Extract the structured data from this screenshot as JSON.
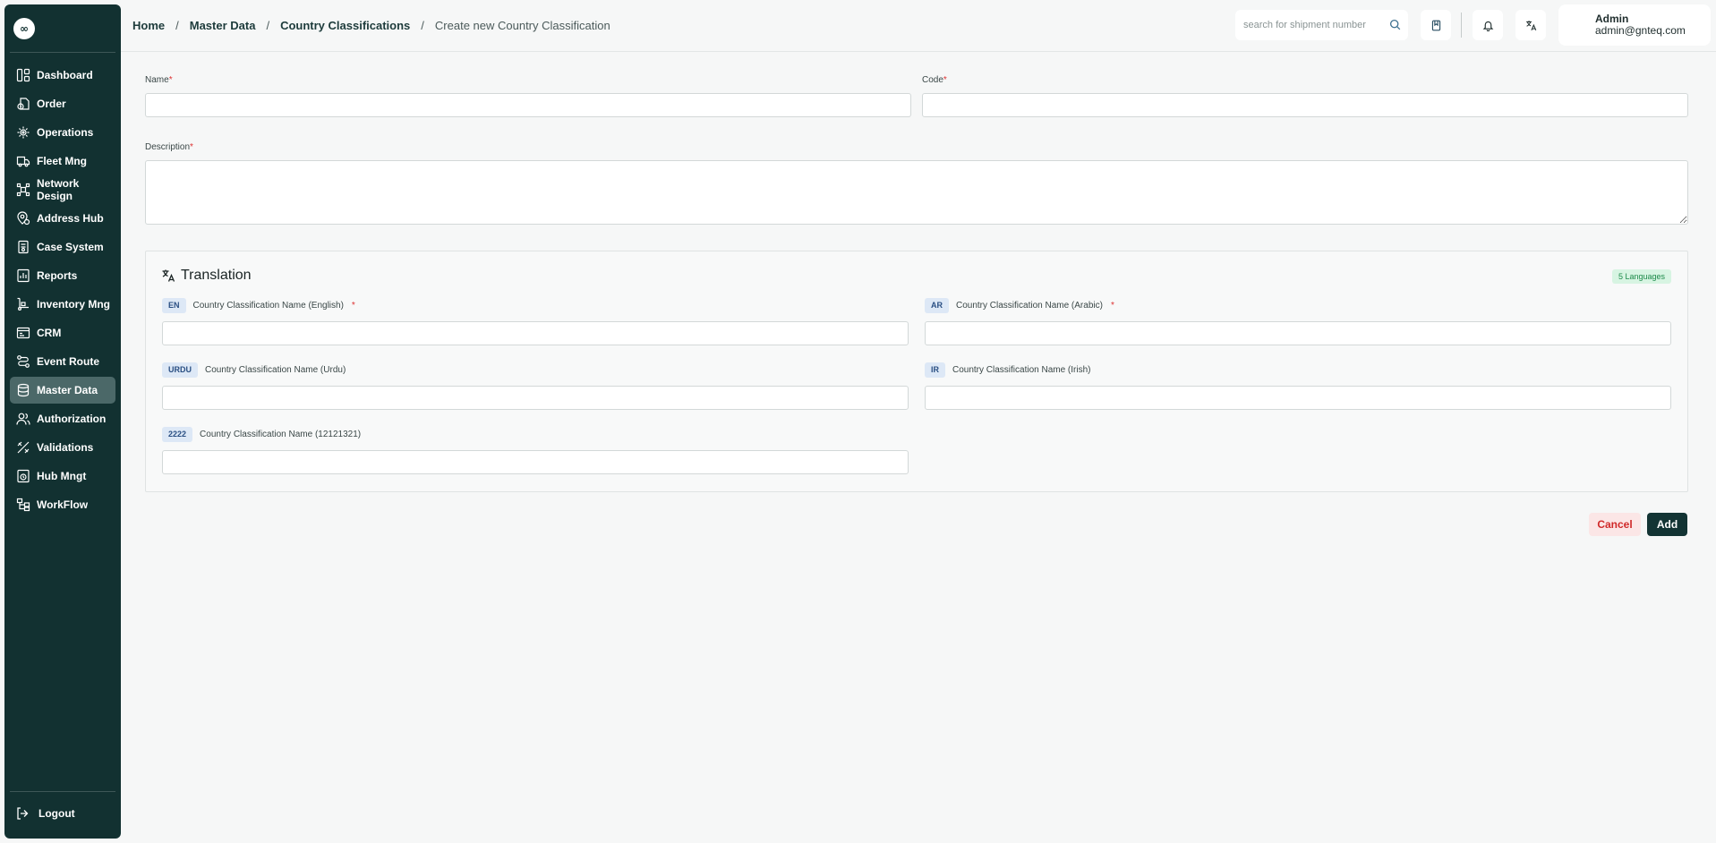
{
  "app": {
    "logo_text": "∞"
  },
  "sidebar": {
    "items": [
      {
        "label": "Dashboard",
        "icon": "dashboard-icon"
      },
      {
        "label": "Order",
        "icon": "order-icon"
      },
      {
        "label": "Operations",
        "icon": "operations-icon"
      },
      {
        "label": "Fleet Mng",
        "icon": "truck-icon"
      },
      {
        "label": "Network Design",
        "icon": "network-icon"
      },
      {
        "label": "Address Hub",
        "icon": "location-icon"
      },
      {
        "label": "Case System",
        "icon": "case-icon"
      },
      {
        "label": "Reports",
        "icon": "reports-icon"
      },
      {
        "label": "Inventory Mng",
        "icon": "inventory-icon"
      },
      {
        "label": "CRM",
        "icon": "crm-icon"
      },
      {
        "label": "Event Route",
        "icon": "route-icon"
      },
      {
        "label": "Master Data",
        "icon": "database-icon",
        "active": true
      },
      {
        "label": "Authorization",
        "icon": "users-icon"
      },
      {
        "label": "Validations",
        "icon": "validations-icon"
      },
      {
        "label": "Hub Mngt",
        "icon": "hub-icon"
      },
      {
        "label": "WorkFlow",
        "icon": "workflow-icon"
      }
    ],
    "logout_label": "Logout"
  },
  "header": {
    "breadcrumb": [
      "Home",
      "Master Data",
      "Country Classifications",
      "Create new Country Classification"
    ],
    "search_placeholder": "search for shipment number",
    "user": {
      "name": "Admin",
      "email": "admin@gnteq.com"
    }
  },
  "form": {
    "name": {
      "label": "Name",
      "value": ""
    },
    "code": {
      "label": "Code",
      "value": ""
    },
    "description": {
      "label": "Description",
      "value": ""
    },
    "required_mark": "*"
  },
  "translation": {
    "title": "Translation",
    "count_badge": "5 Languages",
    "fields": [
      {
        "code": "EN",
        "label": "Country Classification Name (English)",
        "required": true
      },
      {
        "code": "AR",
        "label": "Country Classification Name (Arabic)",
        "required": true
      },
      {
        "code": "URDU",
        "label": "Country Classification Name (Urdu)",
        "required": false
      },
      {
        "code": "IR",
        "label": "Country Classification Name (Irish)",
        "required": false
      },
      {
        "code": "2222",
        "label": "Country Classification Name (12121321)",
        "required": false
      }
    ]
  },
  "actions": {
    "cancel_label": "Cancel",
    "add_label": "Add"
  },
  "colors": {
    "sidebar_bg": "#123131",
    "active_item": "#4b6868",
    "primary": "#133434",
    "danger": "#d02a2a",
    "success_badge": "#1d8a4a"
  }
}
